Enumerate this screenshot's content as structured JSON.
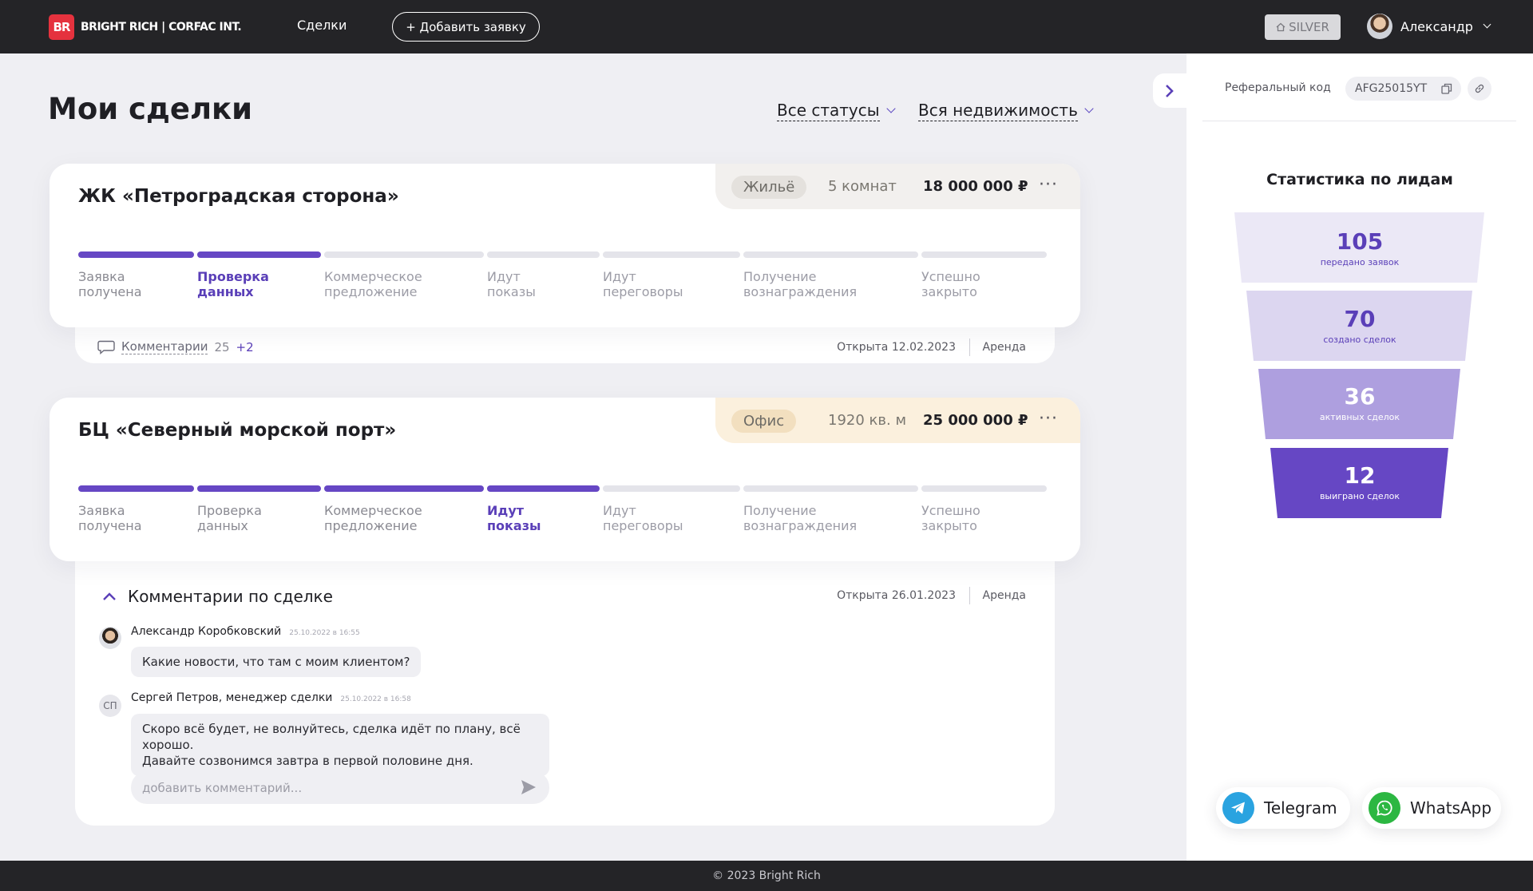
{
  "header": {
    "logo_mark": "BR",
    "logo_text": "BRIGHT RICH | CORFAC INT.",
    "nav_deals": "Сделки",
    "add_button": "+ Добавить заявку",
    "tier": "SILVER",
    "user_name": "Александр"
  },
  "page": {
    "title": "Мои сделки",
    "filter_status": "Все статусы",
    "filter_property": "Вся недвижимость"
  },
  "stage_names": [
    [
      "Заявка",
      "получена"
    ],
    [
      "Проверка",
      "данных"
    ],
    [
      "Коммерческое",
      "предложение"
    ],
    [
      "Идут",
      "показы"
    ],
    [
      "Идут",
      "переговоры"
    ],
    [
      "Получение",
      "вознаграждения"
    ],
    [
      "Успешно",
      "закрыто"
    ]
  ],
  "deals": [
    {
      "title": "ЖК «Петроградская сторона»",
      "type": "Жильё",
      "size": "5 комнат",
      "price": "18 000 000 ₽",
      "more": "···",
      "current_stage": 1,
      "comments_label": "Комментарии",
      "comments_count": "25",
      "comments_new": "+2",
      "opened": "Открыта 12.02.2023",
      "deal_kind": "Аренда"
    },
    {
      "title": "БЦ «Северный морской порт»",
      "type": "Офис",
      "size": "1920 кв. м",
      "price": "25 000 000 ₽",
      "more": "···",
      "current_stage": 3,
      "comments_title": "Комментарии по сделке",
      "opened": "Открыта 26.01.2023",
      "deal_kind": "Аренда",
      "comments": [
        {
          "author": "Александр Коробковский",
          "time": "25.10.2022 в 16:55",
          "lines": [
            "Какие новости, что там с моим клиентом?"
          ]
        },
        {
          "author": "Сергей Петров, менеджер сделки",
          "initials": "СП",
          "time": "25.10.2022 в 16:58",
          "lines": [
            "Скоро всё будет, не волнуйтесь, сделка идёт по плану, всё хорошо.",
            "Давайте созвонимся завтра в первой половине дня."
          ]
        }
      ],
      "comment_placeholder": "добавить комментарий..."
    }
  ],
  "sidebar": {
    "ref_label": "Реферальный код",
    "ref_code": "AFG25015YT",
    "stats_title": "Статистика по лидам",
    "funnel": [
      {
        "value": "105",
        "label": "передано заявок"
      },
      {
        "value": "70",
        "label": "создано сделок"
      },
      {
        "value": "36",
        "label": "активных сделок"
      },
      {
        "value": "12",
        "label": "выиграно сделок"
      }
    ],
    "telegram": "Telegram",
    "whatsapp": "WhatsApp"
  },
  "footer": {
    "copyright": "© 2023 Bright Rich"
  },
  "colors": {
    "accent": "#6647c4",
    "brand_red": "#e5323e",
    "dark": "#242427"
  }
}
